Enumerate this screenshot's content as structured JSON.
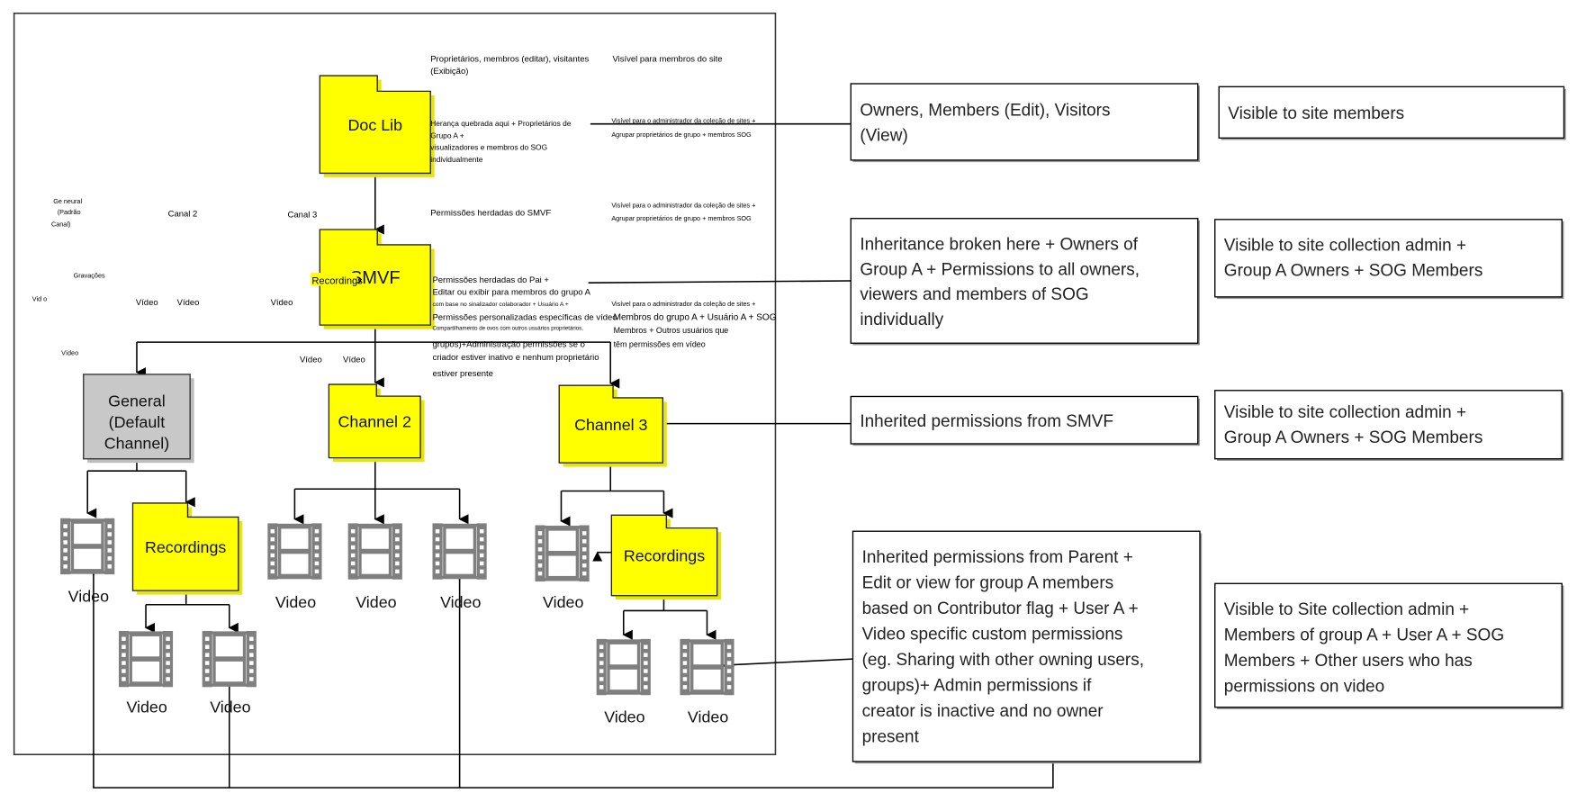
{
  "colors": {
    "folder": "#ffff00",
    "general_box": "#c8c8c8",
    "film_icon": "#7f7f7f",
    "line": "#000000"
  },
  "nodes": {
    "doc_lib": "Doc Lib",
    "smvf": "SMVF",
    "smvf_overlay": "Recordings",
    "general": [
      "General",
      "(Default",
      "Channel)"
    ],
    "channel2": "Channel 2",
    "channel3": "Channel 3",
    "recordings_general": "Recordings",
    "recordings_channel3": "Recordings",
    "video_label": "Video",
    "icon": "film-strip-icon"
  },
  "boxes": {
    "owners": [
      "Owners, Members (Edit), Visitors",
      "(View)"
    ],
    "visible_site": [
      "Visible to site members"
    ],
    "inheritance": [
      "Inheritance broken here + Owners of",
      "Group A +   Permissions to all owners,",
      "viewers and members of SOG",
      "individually"
    ],
    "visible_admin_1": [
      "Visible to site collection admin +",
      "Group A Owners + SOG Members"
    ],
    "inherited_smvf": [
      "Inherited permissions from SMVF"
    ],
    "visible_admin_2": [
      "Visible to site collection admin +",
      "Group A Owners + SOG Members"
    ],
    "video_perms": [
      "Inherited permissions from Parent +",
      "Edit or view for group A members",
      "based on Contributor flag + User A +",
      "Video specific custom permissions",
      "(eg. Sharing with other owning users,",
      "groups)+ Admin permissions if",
      "creator is inactive and no owner",
      "present"
    ],
    "visible_video": [
      "Visible to Site collection admin +",
      "Members of group A + User A + SOG",
      "Members + Other users who has",
      "permissions on video"
    ]
  },
  "pt": {
    "owners": [
      "Proprietários, membros (editar), visitantes",
      "(Exibição)"
    ],
    "visible_site": "Visível para membros do site",
    "inheritance": [
      "Herança quebrada aqui + Proprietários de",
      "Grupo A +",
      "visualizadores e membros do SOG",
      "individualmente"
    ],
    "visible_admin_1": [
      "Visível para o administrador da coleção de sites +",
      "Agrupar proprietários de grupo + membros SOG"
    ],
    "inherited_smvf": "Permissões herdadas do SMVF",
    "visible_admin_2": [
      "Visível para o administrador da coleção de sites +",
      "Agrupar proprietários de grupo +  membros SOG"
    ],
    "video_perms": [
      "Permissões herdadas do Pai +",
      "Editar ou exibir para membros do grupo A",
      "com base no sinalizador colaborador + Usuário A +",
      "Permissões personalizadas específicas de vídeo",
      "Compartilhamento de ovos com outros usuários proprietários,",
      "grupos)+Administração permissões se o",
      "criador estiver inativo e nenhum proprietário",
      "estiver presente"
    ],
    "visible_video": [
      "Visível para o administrador da coleção de sites +",
      "Membros do grupo A + Usuário A + SOG",
      "Membros + Outros usuários que",
      "têm permissões em vídeo"
    ],
    "general": [
      "Ge neural",
      "(Padrão",
      "Canal)"
    ],
    "canal2": "Canal 2",
    "canal3": "Canal 3",
    "gravacoes": "Gravações",
    "vid_o": "Vid o",
    "video": "Vídeo"
  }
}
